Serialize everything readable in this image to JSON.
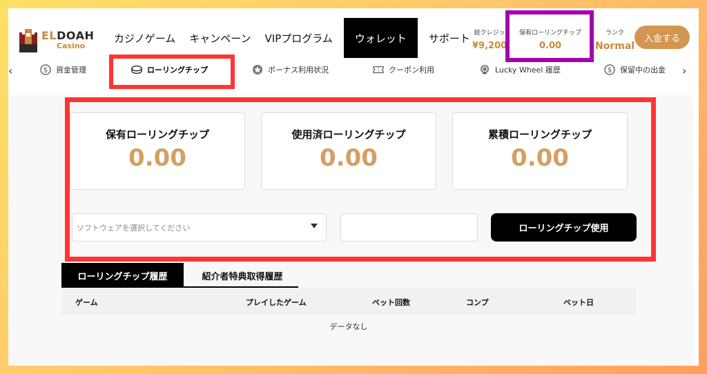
{
  "brand": {
    "name_part1": "EL",
    "name_part2": "DOAH",
    "sub": "Casino"
  },
  "nav": [
    {
      "label": "カジノゲーム"
    },
    {
      "label": "キャンペーン"
    },
    {
      "label": "VIPプログラム"
    },
    {
      "label": "ウォレット",
      "active": true
    },
    {
      "label": "サポート"
    }
  ],
  "header_stats": {
    "credit": {
      "label": "総クレジッ",
      "value": "¥9,200"
    },
    "rolling": {
      "label": "保有ローリングチップ",
      "value": "0.00"
    },
    "rank": {
      "label": "ランク",
      "value": "Normal"
    }
  },
  "deposit_label": "入金する",
  "subnav": {
    "prev_arrow": "‹",
    "next_arrow": "›",
    "items": [
      {
        "label": "資金管理",
        "icon": "dollar-circle-icon"
      },
      {
        "label": "ローリングチップ",
        "icon": "chip-icon",
        "active": true
      },
      {
        "label": "ボーナス利用状況",
        "icon": "star-badge-icon"
      },
      {
        "label": "クーポン利用",
        "icon": "ticket-icon"
      },
      {
        "label": "Lucky Wheel 履歴",
        "icon": "wheel-icon"
      },
      {
        "label": "保留中の出金",
        "icon": "dollar-circle-icon"
      }
    ]
  },
  "cards": [
    {
      "title": "保有ローリングチップ",
      "value": "0.00"
    },
    {
      "title": "使用済ローリングチップ",
      "value": "0.00"
    },
    {
      "title": "累積ローリングチップ",
      "value": "0.00"
    }
  ],
  "form": {
    "select_placeholder": "ソフトウェアを選択してください",
    "amount_value": "",
    "use_button": "ローリングチップ使用"
  },
  "tabs": [
    {
      "label": "ローリングチップ履歴",
      "active": true
    },
    {
      "label": "紹介者特典取得履歴"
    }
  ],
  "table": {
    "columns": [
      "ゲーム",
      "プレイしたゲーム",
      "ベット回数",
      "コンプ",
      "ベット日"
    ],
    "empty_text": "データなし"
  },
  "colors": {
    "accent_gold": "#d3a063",
    "highlight_red": "#ff3434",
    "highlight_purple": "#a400b0"
  }
}
